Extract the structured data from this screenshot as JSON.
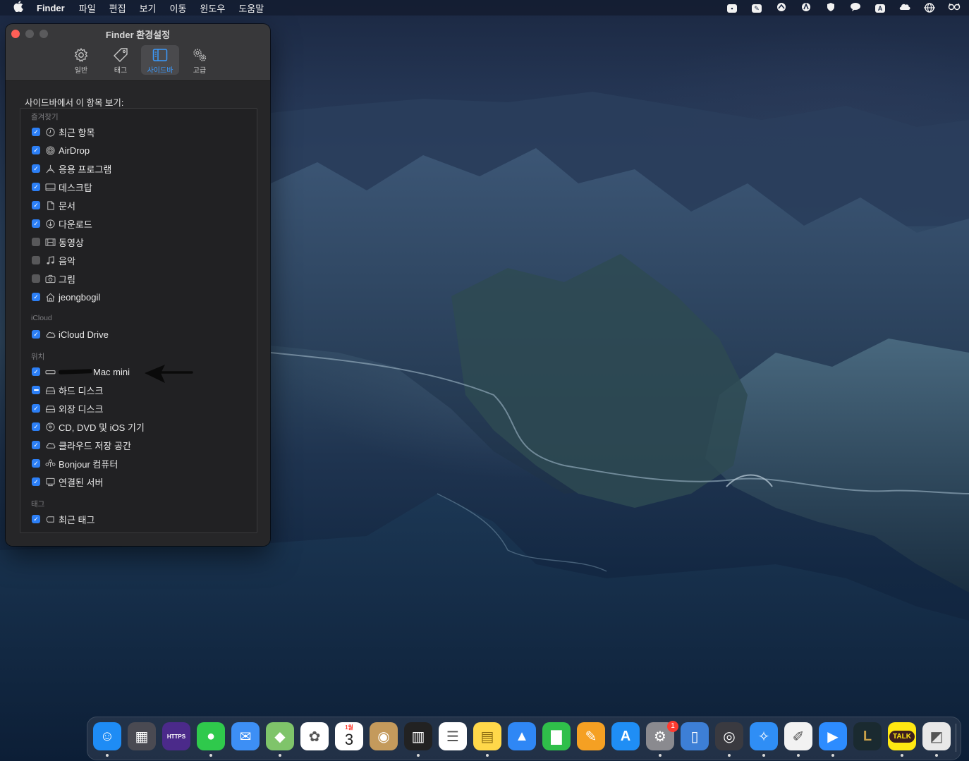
{
  "menubar": {
    "apple": "",
    "app_name": "Finder",
    "items": [
      "파일",
      "편집",
      "보기",
      "이동",
      "윈도우",
      "도움말"
    ],
    "status_icons": [
      "facetime-icon",
      "pen-icon",
      "caster-icon",
      "hat-icon",
      "shield-icon",
      "chat-icon",
      "text-input-icon",
      "cloud-icon",
      "globe-icon",
      "glasses-icon"
    ],
    "text_input_letter": "A"
  },
  "window": {
    "title": "Finder 환경설정",
    "tabs": [
      {
        "label": "일반",
        "icon": "gear-icon"
      },
      {
        "label": "태그",
        "icon": "tag-icon"
      },
      {
        "label": "사이드바",
        "icon": "sidebar-icon"
      },
      {
        "label": "고급",
        "icon": "gears-icon"
      }
    ],
    "active_tab": "사이드바",
    "heading": "사이드바에서 이 항목 보기:",
    "groups": [
      {
        "label": "즐겨찾기",
        "items": [
          {
            "label": "최근 항목",
            "state": "checked",
            "icon": "clock-icon"
          },
          {
            "label": "AirDrop",
            "state": "checked",
            "icon": "airdrop-icon"
          },
          {
            "label": "응용 프로그램",
            "state": "checked",
            "icon": "applications-icon"
          },
          {
            "label": "데스크탑",
            "state": "checked",
            "icon": "desktop-icon"
          },
          {
            "label": "문서",
            "state": "checked",
            "icon": "document-icon"
          },
          {
            "label": "다운로드",
            "state": "checked",
            "icon": "download-icon"
          },
          {
            "label": "동영상",
            "state": "unchecked",
            "icon": "film-icon"
          },
          {
            "label": "음악",
            "state": "unchecked",
            "icon": "music-icon"
          },
          {
            "label": "그림",
            "state": "unchecked",
            "icon": "camera-icon"
          },
          {
            "label": "jeongbogil",
            "state": "checked",
            "icon": "home-icon"
          }
        ]
      },
      {
        "label": "iCloud",
        "items": [
          {
            "label": "iCloud Drive",
            "state": "checked",
            "icon": "cloud-icon"
          }
        ]
      },
      {
        "label": "위치",
        "items": [
          {
            "label": "Mac mini",
            "state": "checked",
            "icon": "mac-mini-icon",
            "redacted_prefix": true
          },
          {
            "label": "하드 디스크",
            "state": "mixed",
            "icon": "disk-icon"
          },
          {
            "label": "외장 디스크",
            "state": "checked",
            "icon": "disk-icon"
          },
          {
            "label": "CD, DVD 및 iOS 기기",
            "state": "checked",
            "icon": "cd-icon"
          },
          {
            "label": "클라우드 저장 공간",
            "state": "checked",
            "icon": "cloud-icon"
          },
          {
            "label": "Bonjour 컴퓨터",
            "state": "checked",
            "icon": "bonjour-icon"
          },
          {
            "label": "연결된 서버",
            "state": "checked",
            "icon": "server-icon"
          }
        ]
      },
      {
        "label": "태그",
        "items": [
          {
            "label": "최근 태그",
            "state": "checked",
            "icon": "tag-outline-icon"
          }
        ]
      }
    ]
  },
  "dock": {
    "apps": [
      {
        "name": "finder",
        "icon": "finder-icon",
        "color": "#1e8cf5",
        "running": true
      },
      {
        "name": "launchpad",
        "icon": "launchpad-icon",
        "color": "#4a4a52",
        "running": false
      },
      {
        "name": "https",
        "icon": "https-icon",
        "color": "#4b2a8a",
        "running": false,
        "text": "HTTPS"
      },
      {
        "name": "messages",
        "icon": "messages-icon",
        "color": "#2fc94c",
        "running": true
      },
      {
        "name": "mail",
        "icon": "mail-icon",
        "color": "#3d8ff5",
        "running": false
      },
      {
        "name": "maps",
        "icon": "maps-icon",
        "color": "#7fc46a",
        "running": true
      },
      {
        "name": "photos",
        "icon": "photos-icon",
        "color": "#ffffff",
        "running": false
      },
      {
        "name": "calendar",
        "icon": "calendar-icon",
        "color": "#ffffff",
        "running": false,
        "month": "1월",
        "day": "3"
      },
      {
        "name": "contacts",
        "icon": "contacts-icon",
        "color": "#c49a5c",
        "running": false
      },
      {
        "name": "piano",
        "icon": "piano-icon",
        "color": "#222222",
        "running": true
      },
      {
        "name": "reminders",
        "icon": "reminders-icon",
        "color": "#ffffff",
        "running": false
      },
      {
        "name": "notes",
        "icon": "notes-icon",
        "color": "#ffd84a",
        "running": true
      },
      {
        "name": "keynote",
        "icon": "keynote-icon",
        "color": "#2f87f5",
        "running": false
      },
      {
        "name": "numbers",
        "icon": "numbers-icon",
        "color": "#2fbf4a",
        "running": false
      },
      {
        "name": "pages",
        "icon": "pages-icon",
        "color": "#f5a023",
        "running": false
      },
      {
        "name": "app-store",
        "icon": "app-store-icon",
        "color": "#1f8ef5",
        "running": false
      },
      {
        "name": "system-preferences",
        "icon": "system-preferences-icon",
        "color": "#8a8a8f",
        "running": true,
        "badge": "1"
      },
      {
        "name": "columns",
        "icon": "columns-icon",
        "color": "#3d7fd6",
        "running": false
      },
      {
        "name": "disk-utility",
        "icon": "disk-utility-icon",
        "color": "#3a3a40",
        "running": true
      },
      {
        "name": "safari",
        "icon": "safari-icon",
        "color": "#2f8ef5",
        "running": true
      },
      {
        "name": "textedit",
        "icon": "textedit-icon",
        "color": "#f2f2f2",
        "running": true
      },
      {
        "name": "zoom",
        "icon": "zoom-icon",
        "color": "#2d8cff",
        "running": true
      },
      {
        "name": "league",
        "icon": "league-icon",
        "color": "#1a2a30",
        "running": false
      },
      {
        "name": "kakaotalk",
        "icon": "kakaotalk-icon",
        "color": "#ffe812",
        "running": true,
        "text": "TALK"
      },
      {
        "name": "preview",
        "icon": "preview-icon",
        "color": "#e8e8e8",
        "running": true
      }
    ]
  }
}
